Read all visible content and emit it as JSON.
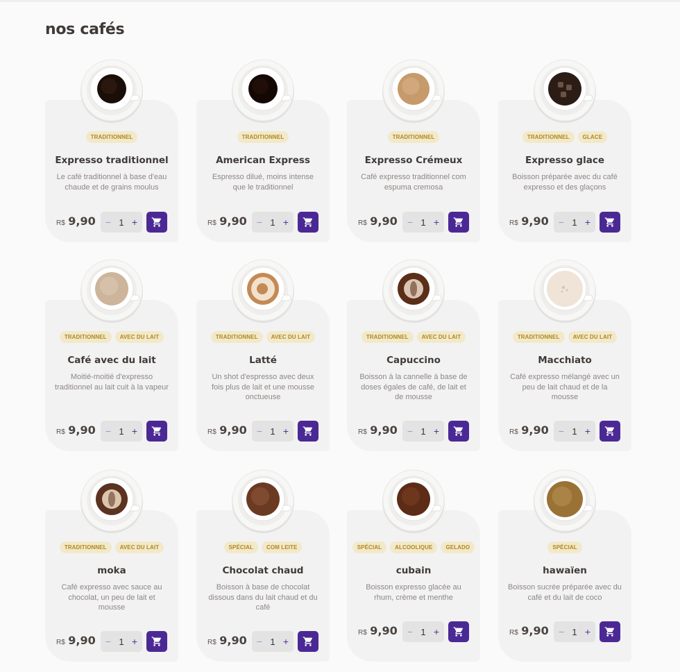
{
  "page": {
    "title": "nos cafés"
  },
  "colors": {
    "accent": "#4b2995",
    "tag_bg": "#f1e9c9",
    "tag_text": "#b3861f",
    "card_bg": "#f3f2f2"
  },
  "icons": {
    "cart": "shopping-cart-icon",
    "minus": "minus-icon",
    "plus": "plus-icon"
  },
  "products": [
    {
      "name": "Expresso traditionnel",
      "tags": [
        "TRADITIONNEL"
      ],
      "description": "Le café traditionnel à base d'eau chaude et de grains moulus",
      "currency": "R$",
      "price": "9,90",
      "quantity": "1",
      "style": "espresso"
    },
    {
      "name": "American Express",
      "tags": [
        "TRADITIONNEL"
      ],
      "description": "Espresso dilué, moins intense que le traditionnel",
      "currency": "R$",
      "price": "9,90",
      "quantity": "1",
      "style": "americano"
    },
    {
      "name": "Expresso Crémeux",
      "tags": [
        "TRADITIONNEL"
      ],
      "description": "Café expresso traditionnel com espuma cremosa",
      "currency": "R$",
      "price": "9,90",
      "quantity": "1",
      "style": "cremeux"
    },
    {
      "name": "Expresso glace",
      "tags": [
        "TRADITIONNEL",
        "GLACE"
      ],
      "description": "Boisson préparée avec du café expresso et des glaçons",
      "currency": "R$",
      "price": "9,90",
      "quantity": "1",
      "style": "iced"
    },
    {
      "name": "Café avec du lait",
      "tags": [
        "TRADITIONNEL",
        "AVEC DU LAIT"
      ],
      "description": "Moitié-moitié d'expresso traditionnel au lait cuit à la vapeur",
      "currency": "R$",
      "price": "9,90",
      "quantity": "1",
      "style": "milk"
    },
    {
      "name": "Latté",
      "tags": [
        "TRADITIONNEL",
        "AVEC DU LAIT"
      ],
      "description": "Un shot d'espresso avec deux fois plus de lait et une mousse onctueuse",
      "currency": "R$",
      "price": "9,90",
      "quantity": "1",
      "style": "latte"
    },
    {
      "name": "Capuccino",
      "tags": [
        "TRADITIONNEL",
        "AVEC DU LAIT"
      ],
      "description": "Boisson à la cannelle à base de doses égales de café, de lait et de mousse",
      "currency": "R$",
      "price": "9,90",
      "quantity": "1",
      "style": "cappuccino"
    },
    {
      "name": "Macchiato",
      "tags": [
        "TRADITIONNEL",
        "AVEC DU LAIT"
      ],
      "description": "Café expresso mélangé avec un peu de lait chaud et de la mousse",
      "currency": "R$",
      "price": "9,90",
      "quantity": "1",
      "style": "macchiato"
    },
    {
      "name": "moka",
      "tags": [
        "TRADITIONNEL",
        "AVEC DU LAIT"
      ],
      "description": "Café expresso avec sauce au chocolat, un peu de lait et mousse",
      "currency": "R$",
      "price": "9,90",
      "quantity": "1",
      "style": "mocha"
    },
    {
      "name": "Chocolat chaud",
      "tags": [
        "SPÉCIAL",
        "COM LEITE"
      ],
      "description": "Boisson à base de chocolat dissous dans du lait chaud et du café",
      "currency": "R$",
      "price": "9,90",
      "quantity": "1",
      "style": "chocolate"
    },
    {
      "name": "cubain",
      "tags": [
        "SPÉCIAL",
        "ALCOOLIQUE",
        "GELADO"
      ],
      "description": "Boisson expresso glacée au rhum, crème et menthe",
      "currency": "R$",
      "price": "9,90",
      "quantity": "1",
      "style": "cuban"
    },
    {
      "name": "hawaïen",
      "tags": [
        "SPÉCIAL"
      ],
      "description": "Boisson sucrée préparée avec du café et du lait de coco",
      "currency": "R$",
      "price": "9,90",
      "quantity": "1",
      "style": "hawaiian"
    }
  ]
}
